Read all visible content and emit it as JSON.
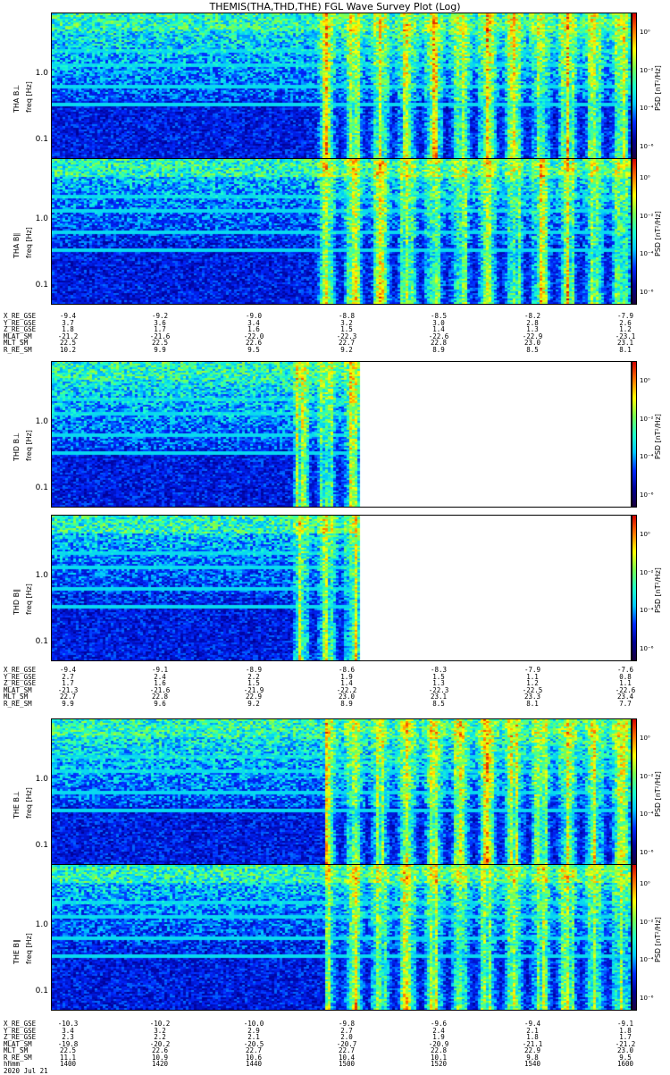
{
  "title": "THEMIS(THA,THD,THE) FGL Wave Survey Plot (Log)",
  "colorbar_label": "PSD [nT²/Hz]",
  "colorbar_ticks": [
    "10⁰",
    "10⁻²",
    "10⁻⁴",
    "10⁻⁶"
  ],
  "y_ticks": [
    "1.0",
    "0.1"
  ],
  "chart_data": [
    {
      "type": "heatmap",
      "ylabel": "THA B⊥",
      "ylabel2": "freq [Hz]",
      "yscale": "log",
      "data_extent": 1.0
    },
    {
      "type": "heatmap",
      "ylabel": "THA B∥",
      "ylabel2": "freq [Hz]",
      "yscale": "log",
      "data_extent": 1.0
    },
    {
      "type": "heatmap",
      "ylabel": "THD B⊥",
      "ylabel2": "freq [Hz]",
      "yscale": "log",
      "data_extent": 0.53
    },
    {
      "type": "heatmap",
      "ylabel": "THD B∥",
      "ylabel2": "freq [Hz]",
      "yscale": "log",
      "data_extent": 0.53
    },
    {
      "type": "heatmap",
      "ylabel": "THE B⊥",
      "ylabel2": "freq [Hz]",
      "yscale": "log",
      "data_extent": 1.0
    },
    {
      "type": "heatmap",
      "ylabel": "THE B∥",
      "ylabel2": "freq [Hz]",
      "yscale": "log",
      "data_extent": 1.0
    }
  ],
  "ephemeris": [
    {
      "rows": [
        {
          "name": "X_RE_GSE",
          "values": [
            "-9.4",
            "-9.2",
            "-9.0",
            "-8.8",
            "-8.5",
            "-8.2",
            "-7.9"
          ]
        },
        {
          "name": "Y_RE_GSE",
          "values": [
            "3.7",
            "3.6",
            "3.4",
            "3.2",
            "3.0",
            "2.8",
            "2.6"
          ]
        },
        {
          "name": "Z_RE_GSE",
          "values": [
            "1.8",
            "1.7",
            "1.6",
            "1.5",
            "1.4",
            "1.3",
            "1.2"
          ]
        },
        {
          "name": "MLAT_SM",
          "values": [
            "-21.2",
            "-21.6",
            "-22.0",
            "-22.3",
            "-22.6",
            "-22.9",
            "-23.1"
          ]
        },
        {
          "name": "MLT_SM",
          "values": [
            "22.5",
            "22.5",
            "22.6",
            "22.7",
            "22.8",
            "23.0",
            "23.1"
          ]
        },
        {
          "name": "R_RE_SM",
          "values": [
            "10.2",
            "9.9",
            "9.5",
            "9.2",
            "8.9",
            "8.5",
            "8.1"
          ]
        }
      ]
    },
    {
      "rows": [
        {
          "name": "X_RE_GSE",
          "values": [
            "-9.4",
            "-9.1",
            "-8.9",
            "-8.6",
            "-8.3",
            "-7.9",
            "-7.6"
          ]
        },
        {
          "name": "Y_RE_GSE",
          "values": [
            "2.7",
            "2.4",
            "2.2",
            "1.9",
            "1.5",
            "1.1",
            "0.8"
          ]
        },
        {
          "name": "Z_RE_GSE",
          "values": [
            "1.7",
            "1.6",
            "1.5",
            "1.4",
            "1.3",
            "1.2",
            "1.1"
          ]
        },
        {
          "name": "MLAT_SM",
          "values": [
            "-21.3",
            "-21.6",
            "-21.9",
            "-22.2",
            "-22.3",
            "-22.5",
            "-22.6"
          ]
        },
        {
          "name": "MLT_SM",
          "values": [
            "22.7",
            "22.8",
            "22.9",
            "23.0",
            "23.1",
            "23.3",
            "23.4"
          ]
        },
        {
          "name": "R_RE_SM",
          "values": [
            "9.9",
            "9.6",
            "9.2",
            "8.9",
            "8.5",
            "8.1",
            "7.7"
          ]
        }
      ]
    },
    {
      "rows": [
        {
          "name": "X_RE_GSE",
          "values": [
            "-10.3",
            "-10.2",
            "-10.0",
            "-9.8",
            "-9.6",
            "-9.4",
            "-9.1"
          ]
        },
        {
          "name": "Y_RE_GSE",
          "values": [
            "3.4",
            "3.2",
            "2.9",
            "2.7",
            "2.4",
            "2.1",
            "1.8"
          ]
        },
        {
          "name": "Z_RE_GSE",
          "values": [
            "2.3",
            "2.2",
            "2.1",
            "2.0",
            "1.9",
            "1.8",
            "1.7"
          ]
        },
        {
          "name": "MLAT_SM",
          "values": [
            "-19.8",
            "-20.2",
            "-20.5",
            "-20.7",
            "-20.9",
            "-21.1",
            "-21.2"
          ]
        },
        {
          "name": "MLT_SM",
          "values": [
            "22.5",
            "22.6",
            "22.7",
            "22.7",
            "22.8",
            "22.9",
            "23.0"
          ]
        },
        {
          "name": "R_RE_SM",
          "values": [
            "11.1",
            "10.9",
            "10.6",
            "10.4",
            "10.1",
            "9.8",
            "9.5"
          ]
        },
        {
          "name": "hhmm",
          "values": [
            "1400",
            "1420",
            "1440",
            "1500",
            "1520",
            "1540",
            "1600"
          ]
        },
        {
          "name": "2020 Jul 21",
          "values": []
        }
      ]
    }
  ]
}
